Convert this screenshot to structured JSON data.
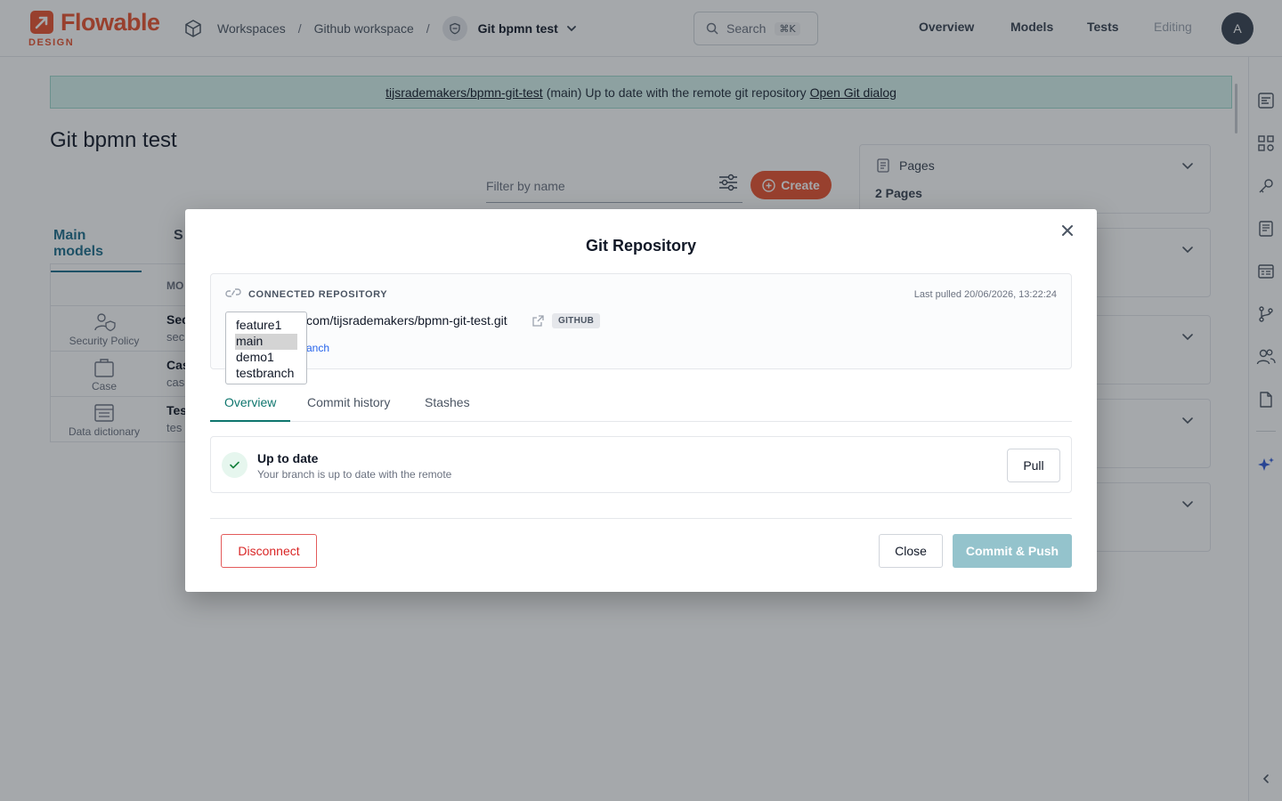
{
  "header": {
    "logo_word": "Flowable",
    "logo_sub": "DESIGN",
    "breadcrumb": {
      "workspaces": "Workspaces",
      "workspace": "Github workspace",
      "project": "Git bpmn test",
      "separator": "/"
    },
    "search": {
      "placeholder": "Search",
      "shortcut": "⌘K"
    },
    "nav": {
      "overview": "Overview",
      "models": "Models",
      "tests": "Tests",
      "editing": "Editing"
    },
    "avatar_initial": "A"
  },
  "banner": {
    "repo_link": "tijsrademakers/bpmn-git-test",
    "branch": "(main)",
    "status": "Up to date with the remote git repository",
    "dialog_link": "Open Git dialog"
  },
  "page": {
    "title": "Git bpmn test",
    "filter_placeholder": "Filter by name",
    "create_label": "Create",
    "tabs": {
      "main": "Main models",
      "second": "S"
    },
    "table": {
      "col_header": "MO",
      "rows": [
        {
          "type": "Security Policy",
          "name": "Sec",
          "key": "sec",
          "icon": "security-policy-icon"
        },
        {
          "type": "Case",
          "name": "Cas",
          "key": "cas",
          "icon": "case-icon"
        },
        {
          "type": "Data dictionary",
          "name": "Tes",
          "key": "tes",
          "icon": "data-dictionary-icon"
        }
      ]
    },
    "side_panels": [
      {
        "title": "Pages",
        "subtitle": "2 Pages"
      }
    ]
  },
  "modal": {
    "title": "Git Repository",
    "repo": {
      "label": "CONNECTED REPOSITORY",
      "last_pulled": "Last pulled 20/06/2026, 13:22:24",
      "url_visible": "com/tijsrademakers/bpmn-git-test.git",
      "provider": "GITHUB",
      "switch_branch_visible": "anch"
    },
    "branches": [
      "feature1",
      "main",
      "demo1",
      "testbranch"
    ],
    "selected_branch": "main",
    "tabs": [
      "Overview",
      "Commit history",
      "Stashes"
    ],
    "active_tab": "Overview",
    "status": {
      "title": "Up to date",
      "subtitle": "Your branch is up to date with the remote",
      "pull_label": "Pull"
    },
    "buttons": {
      "disconnect": "Disconnect",
      "close": "Close",
      "commit_push": "Commit & Push"
    }
  },
  "colors": {
    "brand": "#e9522f",
    "accent_teal": "#0f766e",
    "banner_bg": "#d7f4ef",
    "danger": "#d92626",
    "commit_disabled": "#94c3cc",
    "link_blue": "#2563eb"
  }
}
